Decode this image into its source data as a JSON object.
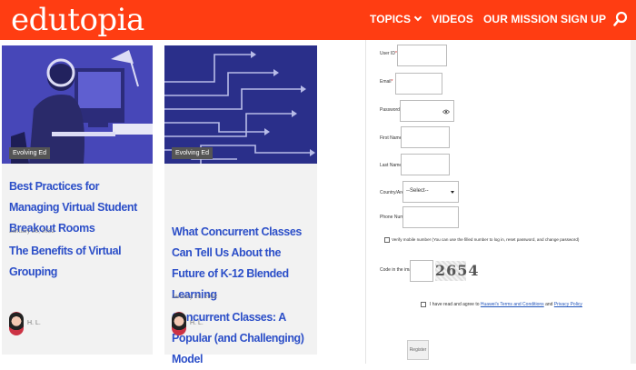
{
  "header": {
    "logo": "edutopia",
    "nav": {
      "topics": "TOPICS",
      "videos": "VIDEOS",
      "mission": "OUR MISSION",
      "signup": "SIGN UP"
    },
    "icons": {
      "search": "search-icon",
      "topics_menu": "chevron-down-icon"
    }
  },
  "cards": [
    {
      "badge": "Evolving Ed",
      "title": "Best Practices for Managing Virtual Student Breakout Rooms",
      "date": "January 26, 2022",
      "related_title": "The Benefits of Virtual Grouping",
      "author": "H. L."
    },
    {
      "badge": "Evolving Ed",
      "title": "What Concurrent Classes Can Tell Us About the Future of K-12 Blended Learning",
      "date": "January 26, 2022",
      "related_title": "Concurrent Classes: A Popular (and Challenging) Model",
      "author": "H. L."
    }
  ],
  "form": {
    "user_id": {
      "label": "User ID",
      "value": ""
    },
    "email": {
      "label": "Email",
      "value": ""
    },
    "password": {
      "label": "Password",
      "value": ""
    },
    "first_name": {
      "label": "First Name",
      "value": ""
    },
    "last_name": {
      "label": "Last Name",
      "value": ""
    },
    "country": {
      "label": "Country/Area",
      "selected": "--Select--"
    },
    "phone": {
      "label": "Phone Number",
      "value": ""
    },
    "phone_checkbox_text": "Verify mobile number (You can use the filled number to log in, reset password, and change password)",
    "captcha_label": "Code in the image",
    "captcha_text": "2654",
    "terms_prefix": "I have read and agree to",
    "terms_link": "Huawei's Terms and Conditions",
    "terms_and": "and",
    "privacy_link": "Privacy Policy",
    "register_label": "Register"
  },
  "colors": {
    "brand": "#ff3d12",
    "link": "#2c4fc8",
    "card_bg": "#f2f2f2"
  }
}
